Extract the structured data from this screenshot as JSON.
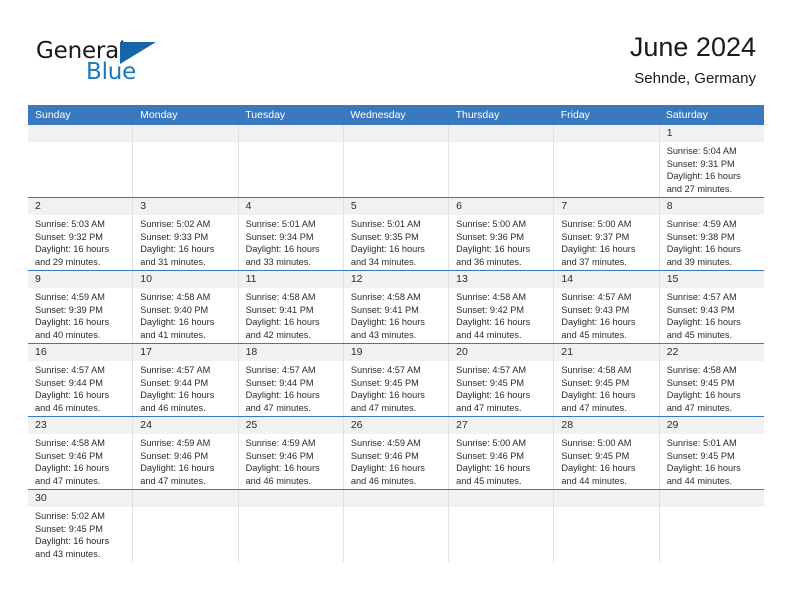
{
  "brand": {
    "name_part1": "General",
    "name_part2": "Blue",
    "logo_icon": "blue-triangle",
    "color_blue": "#1878bd",
    "color_dark": "#1a1a1a"
  },
  "header": {
    "title": "June 2024",
    "subtitle": "Sehnde, Germany"
  },
  "colors": {
    "header_bar": "#3a79bd",
    "date_band": "#f1f1f1",
    "week_separator": "#3a79bd",
    "cell_divider": "#e2e2e2"
  },
  "weekdays": [
    "Sunday",
    "Monday",
    "Tuesday",
    "Wednesday",
    "Thursday",
    "Friday",
    "Saturday"
  ],
  "weeks": [
    [
      {
        "day": "",
        "l1": "",
        "l2": "",
        "l3": "",
        "l4": ""
      },
      {
        "day": "",
        "l1": "",
        "l2": "",
        "l3": "",
        "l4": ""
      },
      {
        "day": "",
        "l1": "",
        "l2": "",
        "l3": "",
        "l4": ""
      },
      {
        "day": "",
        "l1": "",
        "l2": "",
        "l3": "",
        "l4": ""
      },
      {
        "day": "",
        "l1": "",
        "l2": "",
        "l3": "",
        "l4": ""
      },
      {
        "day": "",
        "l1": "",
        "l2": "",
        "l3": "",
        "l4": ""
      },
      {
        "day": "1",
        "l1": "Sunrise: 5:04 AM",
        "l2": "Sunset: 9:31 PM",
        "l3": "Daylight: 16 hours",
        "l4": "and 27 minutes."
      }
    ],
    [
      {
        "day": "2",
        "l1": "Sunrise: 5:03 AM",
        "l2": "Sunset: 9:32 PM",
        "l3": "Daylight: 16 hours",
        "l4": "and 29 minutes."
      },
      {
        "day": "3",
        "l1": "Sunrise: 5:02 AM",
        "l2": "Sunset: 9:33 PM",
        "l3": "Daylight: 16 hours",
        "l4": "and 31 minutes."
      },
      {
        "day": "4",
        "l1": "Sunrise: 5:01 AM",
        "l2": "Sunset: 9:34 PM",
        "l3": "Daylight: 16 hours",
        "l4": "and 33 minutes."
      },
      {
        "day": "5",
        "l1": "Sunrise: 5:01 AM",
        "l2": "Sunset: 9:35 PM",
        "l3": "Daylight: 16 hours",
        "l4": "and 34 minutes."
      },
      {
        "day": "6",
        "l1": "Sunrise: 5:00 AM",
        "l2": "Sunset: 9:36 PM",
        "l3": "Daylight: 16 hours",
        "l4": "and 36 minutes."
      },
      {
        "day": "7",
        "l1": "Sunrise: 5:00 AM",
        "l2": "Sunset: 9:37 PM",
        "l3": "Daylight: 16 hours",
        "l4": "and 37 minutes."
      },
      {
        "day": "8",
        "l1": "Sunrise: 4:59 AM",
        "l2": "Sunset: 9:38 PM",
        "l3": "Daylight: 16 hours",
        "l4": "and 39 minutes."
      }
    ],
    [
      {
        "day": "9",
        "l1": "Sunrise: 4:59 AM",
        "l2": "Sunset: 9:39 PM",
        "l3": "Daylight: 16 hours",
        "l4": "and 40 minutes."
      },
      {
        "day": "10",
        "l1": "Sunrise: 4:58 AM",
        "l2": "Sunset: 9:40 PM",
        "l3": "Daylight: 16 hours",
        "l4": "and 41 minutes."
      },
      {
        "day": "11",
        "l1": "Sunrise: 4:58 AM",
        "l2": "Sunset: 9:41 PM",
        "l3": "Daylight: 16 hours",
        "l4": "and 42 minutes."
      },
      {
        "day": "12",
        "l1": "Sunrise: 4:58 AM",
        "l2": "Sunset: 9:41 PM",
        "l3": "Daylight: 16 hours",
        "l4": "and 43 minutes."
      },
      {
        "day": "13",
        "l1": "Sunrise: 4:58 AM",
        "l2": "Sunset: 9:42 PM",
        "l3": "Daylight: 16 hours",
        "l4": "and 44 minutes."
      },
      {
        "day": "14",
        "l1": "Sunrise: 4:57 AM",
        "l2": "Sunset: 9:43 PM",
        "l3": "Daylight: 16 hours",
        "l4": "and 45 minutes."
      },
      {
        "day": "15",
        "l1": "Sunrise: 4:57 AM",
        "l2": "Sunset: 9:43 PM",
        "l3": "Daylight: 16 hours",
        "l4": "and 45 minutes."
      }
    ],
    [
      {
        "day": "16",
        "l1": "Sunrise: 4:57 AM",
        "l2": "Sunset: 9:44 PM",
        "l3": "Daylight: 16 hours",
        "l4": "and 46 minutes."
      },
      {
        "day": "17",
        "l1": "Sunrise: 4:57 AM",
        "l2": "Sunset: 9:44 PM",
        "l3": "Daylight: 16 hours",
        "l4": "and 46 minutes."
      },
      {
        "day": "18",
        "l1": "Sunrise: 4:57 AM",
        "l2": "Sunset: 9:44 PM",
        "l3": "Daylight: 16 hours",
        "l4": "and 47 minutes."
      },
      {
        "day": "19",
        "l1": "Sunrise: 4:57 AM",
        "l2": "Sunset: 9:45 PM",
        "l3": "Daylight: 16 hours",
        "l4": "and 47 minutes."
      },
      {
        "day": "20",
        "l1": "Sunrise: 4:57 AM",
        "l2": "Sunset: 9:45 PM",
        "l3": "Daylight: 16 hours",
        "l4": "and 47 minutes."
      },
      {
        "day": "21",
        "l1": "Sunrise: 4:58 AM",
        "l2": "Sunset: 9:45 PM",
        "l3": "Daylight: 16 hours",
        "l4": "and 47 minutes."
      },
      {
        "day": "22",
        "l1": "Sunrise: 4:58 AM",
        "l2": "Sunset: 9:45 PM",
        "l3": "Daylight: 16 hours",
        "l4": "and 47 minutes."
      }
    ],
    [
      {
        "day": "23",
        "l1": "Sunrise: 4:58 AM",
        "l2": "Sunset: 9:46 PM",
        "l3": "Daylight: 16 hours",
        "l4": "and 47 minutes."
      },
      {
        "day": "24",
        "l1": "Sunrise: 4:59 AM",
        "l2": "Sunset: 9:46 PM",
        "l3": "Daylight: 16 hours",
        "l4": "and 47 minutes."
      },
      {
        "day": "25",
        "l1": "Sunrise: 4:59 AM",
        "l2": "Sunset: 9:46 PM",
        "l3": "Daylight: 16 hours",
        "l4": "and 46 minutes."
      },
      {
        "day": "26",
        "l1": "Sunrise: 4:59 AM",
        "l2": "Sunset: 9:46 PM",
        "l3": "Daylight: 16 hours",
        "l4": "and 46 minutes."
      },
      {
        "day": "27",
        "l1": "Sunrise: 5:00 AM",
        "l2": "Sunset: 9:46 PM",
        "l3": "Daylight: 16 hours",
        "l4": "and 45 minutes."
      },
      {
        "day": "28",
        "l1": "Sunrise: 5:00 AM",
        "l2": "Sunset: 9:45 PM",
        "l3": "Daylight: 16 hours",
        "l4": "and 44 minutes."
      },
      {
        "day": "29",
        "l1": "Sunrise: 5:01 AM",
        "l2": "Sunset: 9:45 PM",
        "l3": "Daylight: 16 hours",
        "l4": "and 44 minutes."
      }
    ],
    [
      {
        "day": "30",
        "l1": "Sunrise: 5:02 AM",
        "l2": "Sunset: 9:45 PM",
        "l3": "Daylight: 16 hours",
        "l4": "and 43 minutes."
      },
      {
        "day": "",
        "l1": "",
        "l2": "",
        "l3": "",
        "l4": ""
      },
      {
        "day": "",
        "l1": "",
        "l2": "",
        "l3": "",
        "l4": ""
      },
      {
        "day": "",
        "l1": "",
        "l2": "",
        "l3": "",
        "l4": ""
      },
      {
        "day": "",
        "l1": "",
        "l2": "",
        "l3": "",
        "l4": ""
      },
      {
        "day": "",
        "l1": "",
        "l2": "",
        "l3": "",
        "l4": ""
      },
      {
        "day": "",
        "l1": "",
        "l2": "",
        "l3": "",
        "l4": ""
      }
    ]
  ]
}
